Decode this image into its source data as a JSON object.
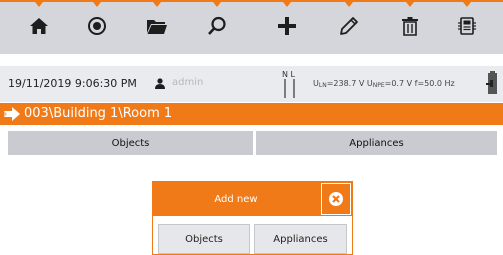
{
  "toolbar": {
    "accent_color": "#f07a18",
    "icons": [
      "home-icon",
      "target-icon",
      "folder-icon",
      "search-icon",
      "plus-icon",
      "pencil-icon",
      "trash-icon",
      "memory-icon"
    ]
  },
  "status": {
    "datetime": "19/11/2019 9:06:30 PM",
    "user": "admin",
    "nl_label": "N L",
    "readings": {
      "uln_label": "U",
      "uln_sub": "LN",
      "uln_value": "=238.7 V",
      "unpe_label": "U",
      "unpe_sub": "NPE",
      "unpe_value": "=0.7 V",
      "freq": "f=50.0 Hz"
    }
  },
  "path": {
    "text": "003\\Building 1\\Room 1"
  },
  "tabs": {
    "objects": "Objects",
    "appliances": "Appliances"
  },
  "dialog": {
    "title": "Add new",
    "objects_button": "Objects",
    "appliances_button": "Appliances"
  }
}
